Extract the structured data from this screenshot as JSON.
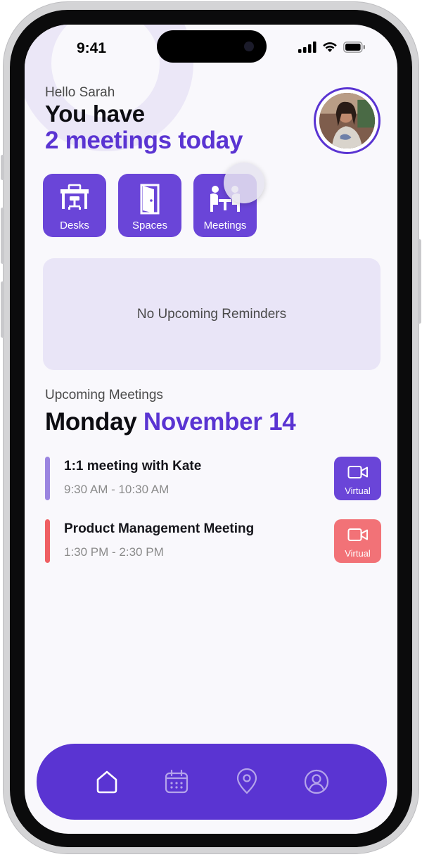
{
  "status_bar": {
    "time": "9:41"
  },
  "header": {
    "greeting": "Hello Sarah",
    "title_line1": "You have",
    "title_line2": "2 meetings today"
  },
  "quick_actions": [
    {
      "label": "Desks",
      "icon": "desk-icon"
    },
    {
      "label": "Spaces",
      "icon": "door-icon"
    },
    {
      "label": "Meetings",
      "icon": "meeting-people-icon"
    }
  ],
  "reminders": {
    "empty_text": "No Upcoming Reminders"
  },
  "upcoming": {
    "section_label": "Upcoming Meetings",
    "day": "Monday",
    "date": "November 14",
    "meetings": [
      {
        "title": "1:1 meeting with Kate",
        "time": "9:30 AM - 10:30 AM",
        "type_label": "Virtual",
        "accent": "#9b85e0",
        "button_color": "#6a45d8"
      },
      {
        "title": "Product Management Meeting",
        "time": "1:30 PM - 2:30 PM",
        "type_label": "Virtual",
        "accent": "#ef5f63",
        "button_color": "#f27277"
      }
    ]
  },
  "bottom_nav": {
    "items": [
      {
        "icon": "home-icon",
        "active": true
      },
      {
        "icon": "calendar-icon",
        "active": false
      },
      {
        "icon": "location-pin-icon",
        "active": false
      },
      {
        "icon": "profile-icon",
        "active": false
      }
    ]
  },
  "colors": {
    "brand": "#5a34d2",
    "quick_button": "#6a45d8",
    "reminder_card": "#e9e5f7"
  }
}
